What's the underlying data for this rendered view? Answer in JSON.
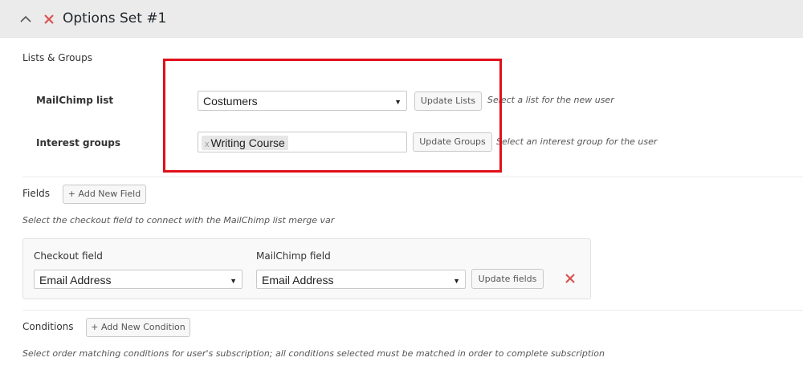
{
  "header": {
    "title": "Options Set #1",
    "collapse_icon": "chevron-up-icon",
    "remove_icon": "close-icon"
  },
  "lists_groups": {
    "section_title": "Lists & Groups",
    "mailchimp_list": {
      "label": "MailChimp list",
      "selected": "Costumers",
      "button": "Update Lists",
      "description": "Select a list for the new user"
    },
    "interest_groups": {
      "label": "Interest groups",
      "tag_remove": "x",
      "tag": "Writing Course",
      "button": "Update Groups",
      "description": "Select an interest group for the user"
    }
  },
  "fields": {
    "section_title": "Fields",
    "add_button": "+ Add New Field",
    "description": "Select the checkout field to connect with the MailChimp list merge var",
    "checkout_field": {
      "label": "Checkout field",
      "selected": "Email Address"
    },
    "mailchimp_field": {
      "label": "MailChimp field",
      "selected": "Email Address"
    },
    "update_button": "Update fields"
  },
  "conditions": {
    "section_title": "Conditions",
    "add_button": "+ Add New Condition",
    "description": "Select order matching conditions for user's subscription; all conditions selected must be matched in order to complete subscription"
  },
  "colors": {
    "header_bg": "#ebebeb",
    "remove_red": "#d9534f",
    "highlight_red": "#e0101b"
  }
}
